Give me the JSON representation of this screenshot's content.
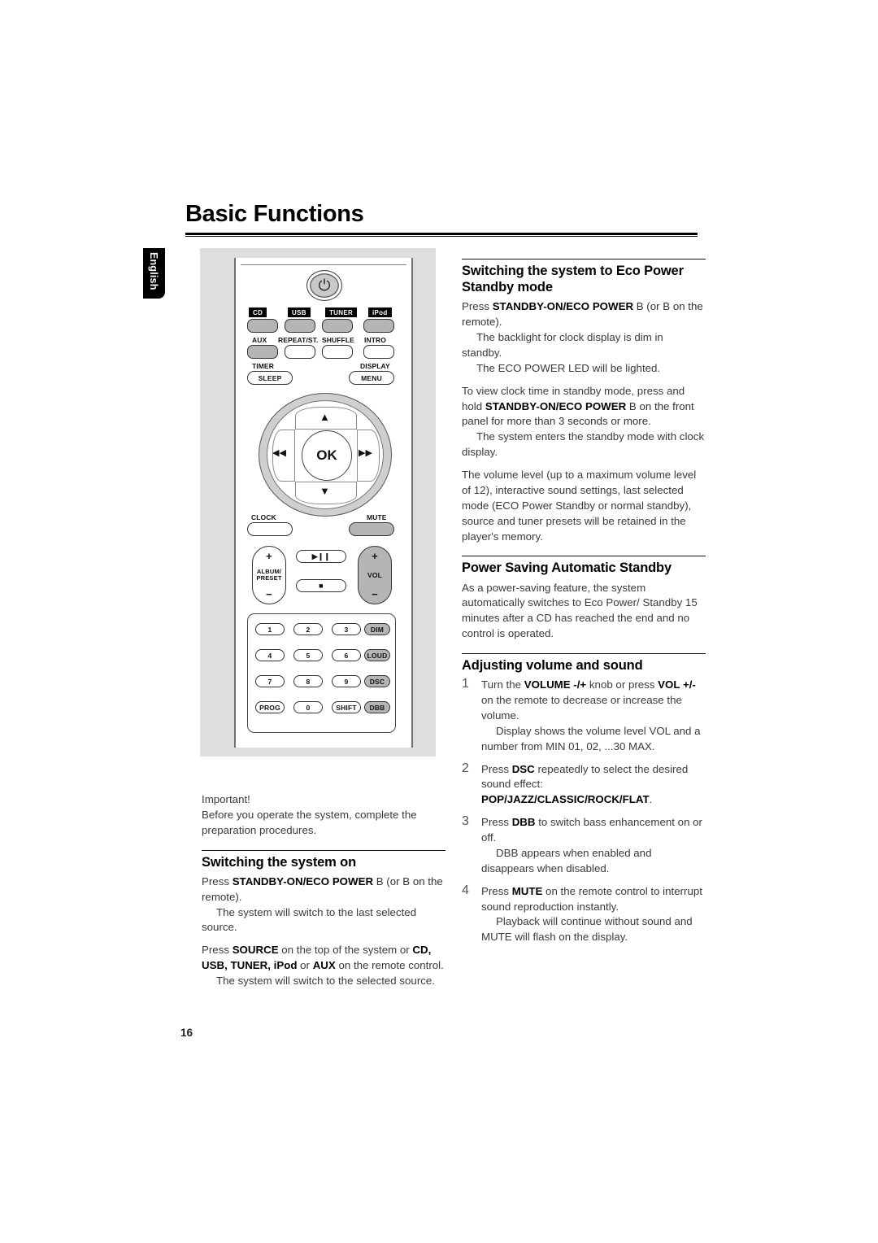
{
  "page": {
    "title": "Basic Functions",
    "language_tab": "English",
    "number": "16"
  },
  "remote": {
    "power_icon": "power-icon",
    "source_badges": [
      "CD",
      "USB",
      "TUNER",
      "iPod"
    ],
    "row2_labels": [
      "AUX",
      "REPEAT/ST.",
      "SHUFFLE",
      "INTRO"
    ],
    "row3_labels": [
      "TIMER",
      "DISPLAY"
    ],
    "row3_buttons": [
      "SLEEP",
      "MENU"
    ],
    "nav": {
      "center": "OK",
      "up": "▲",
      "down": "▼",
      "left": "◀◀",
      "right": "▶▶"
    },
    "clock_label": "CLOCK",
    "mute_label": "MUTE",
    "album_preset": {
      "plus": "+",
      "label1": "ALBUM/",
      "label2": "PRESET",
      "minus": "−"
    },
    "vol": {
      "plus": "+",
      "label": "VOL",
      "minus": "−"
    },
    "transport": {
      "play_pause": "▶❙❙",
      "stop": "■"
    },
    "keypad": [
      [
        "1",
        "2",
        "3",
        "DIM"
      ],
      [
        "4",
        "5",
        "6",
        "LOUD"
      ],
      [
        "7",
        "8",
        "9",
        "DSC"
      ],
      [
        "PROG",
        "0",
        "SHIFT",
        "DBB"
      ]
    ]
  },
  "left_column": {
    "important": {
      "label": "Important!",
      "text": "Before you operate the system, complete the preparation procedures."
    },
    "switching_on": {
      "heading": "Switching the system on",
      "p1_pre": "Press ",
      "p1_bold": "STANDBY-ON/ECO POWER",
      "p1_post": " B  (or B  on the remote).",
      "p1_sub": "The system will switch to the last selected source.",
      "p2_pre": "Press ",
      "p2_bold": "SOURCE",
      "p2_mid": " on the top of the system or ",
      "p2_sources": "CD, USB, TUNER, iPod",
      "p2_or": " or ",
      "p2_aux": "AUX",
      "p2_post": " on the remote control.",
      "p2_sub": "The system will switch to the selected source."
    }
  },
  "right_column": {
    "eco_standby": {
      "heading": "Switching the system to Eco Power Standby mode",
      "p1_pre": "Press ",
      "p1_bold": "STANDBY-ON/ECO POWER",
      "p1_post": " B  (or B  on the remote).",
      "p1_sub1": "The backlight for clock display is dim in standby.",
      "p1_sub2": "The ECO POWER LED will be lighted.",
      "p2_pre": "To view clock time in standby mode, press and hold ",
      "p2_bold": "STANDBY-ON/ECO POWER",
      "p2_post": " B  on the front panel for more than 3 seconds or more.",
      "p2_sub": "The system enters the standby mode with clock display.",
      "p3": "The volume level (up to a maximum volume level of 12), interactive sound settings, last selected mode (ECO Power  Standby or normal standby), source and tuner presets will be retained in the player's memory."
    },
    "auto_standby": {
      "heading": "Power Saving Automatic Standby",
      "text": "As a power-saving feature, the system automatically switches to Eco Power/ Standby 15 minutes after a CD has reached the end and no control is operated."
    },
    "volume_sound": {
      "heading": "Adjusting volume and sound",
      "steps": [
        {
          "num": "1",
          "pre": "Turn the ",
          "bold1": "VOLUME -/+",
          "mid": " knob or press ",
          "bold2": "VOL +/-",
          "post": " on the remote to decrease or increase the volume.",
          "sub": "Display shows the volume level VOL and a number from MIN 01, 02, ...30 MAX."
        },
        {
          "num": "2",
          "pre": "Press ",
          "bold1": "DSC",
          "mid": " repeatedly to select the desired sound effect: ",
          "bold2": "POP/JAZZ/CLASSIC/ROCK/FLAT",
          "post": ".",
          "sub": ""
        },
        {
          "num": "3",
          "pre": "Press ",
          "bold1": "DBB",
          "mid": " to switch bass enhancement on or off.",
          "bold2": "",
          "post": "",
          "sub": "DBB appears when enabled and disappears when disabled."
        },
        {
          "num": "4",
          "pre": "Press ",
          "bold1": "MUTE",
          "mid": " on the remote control to interrupt sound reproduction instantly.",
          "bold2": "",
          "post": "",
          "sub": "Playback will continue without sound and MUTE will flash on the display."
        }
      ]
    }
  }
}
